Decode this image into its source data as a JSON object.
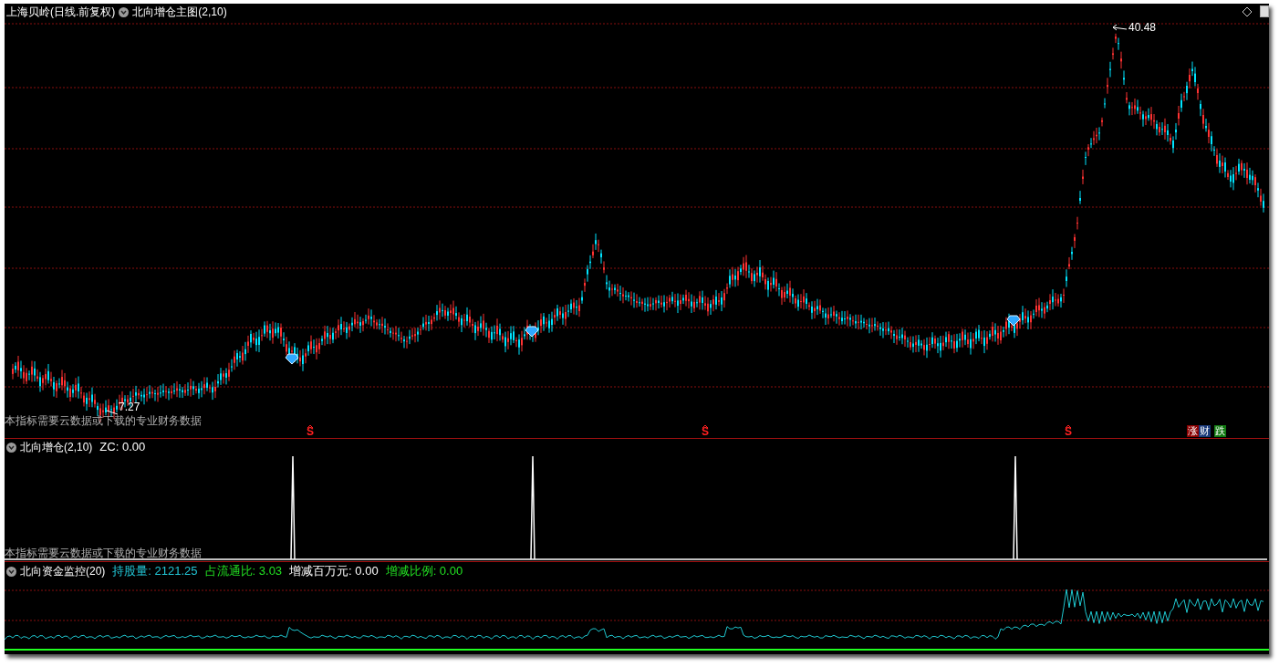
{
  "main": {
    "stock": "上海贝岭",
    "period": "(日线.前复权)",
    "indicator": "北向增仓主图(2,10)",
    "high_label": "40.48",
    "low_label": "7.27",
    "notice": "本指标需要云数据或下载的专业财务数据",
    "sell_marks": [
      "S",
      "S",
      "S"
    ],
    "badges": [
      {
        "text": "涨",
        "color": "#8b0000"
      },
      {
        "text": "财",
        "color": "#1a3a7a"
      },
      {
        "text": "跌",
        "color": "#117a11"
      }
    ]
  },
  "panel2": {
    "indicator": "北向增仓(2,10)",
    "readings": [
      {
        "label": "ZC:",
        "value": "0.00",
        "color": "#ffffff"
      }
    ],
    "notice": "本指标需要云数据或下载的专业财务数据"
  },
  "panel3": {
    "indicator": "北向资金监控(20)",
    "readings": [
      {
        "label": "持股量:",
        "value": "2121.25",
        "color": "#22c6d6"
      },
      {
        "label": "占流通比:",
        "value": "3.03",
        "color": "#22e022"
      },
      {
        "label": "增减百万元:",
        "value": "0.00",
        "color": "#ffffff"
      },
      {
        "label": "增减比例:",
        "value": "0.00",
        "color": "#22e022"
      }
    ]
  }
}
